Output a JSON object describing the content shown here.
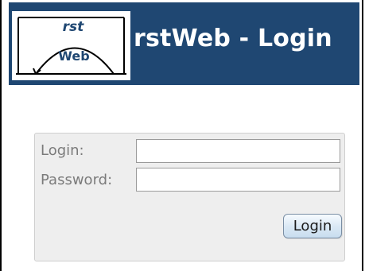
{
  "header": {
    "logo": {
      "text_top": "rst",
      "text_bottom": "Web"
    },
    "title": "rstWeb - Login"
  },
  "form": {
    "login_label": "Login:",
    "password_label": "Password:",
    "login_value": "",
    "password_value": "",
    "submit_label": "Login"
  },
  "colors": {
    "header_bg": "#1f4772",
    "panel_bg": "#eeeeee",
    "panel_border": "#cfcfcf",
    "label_text": "#7b7b7b"
  }
}
